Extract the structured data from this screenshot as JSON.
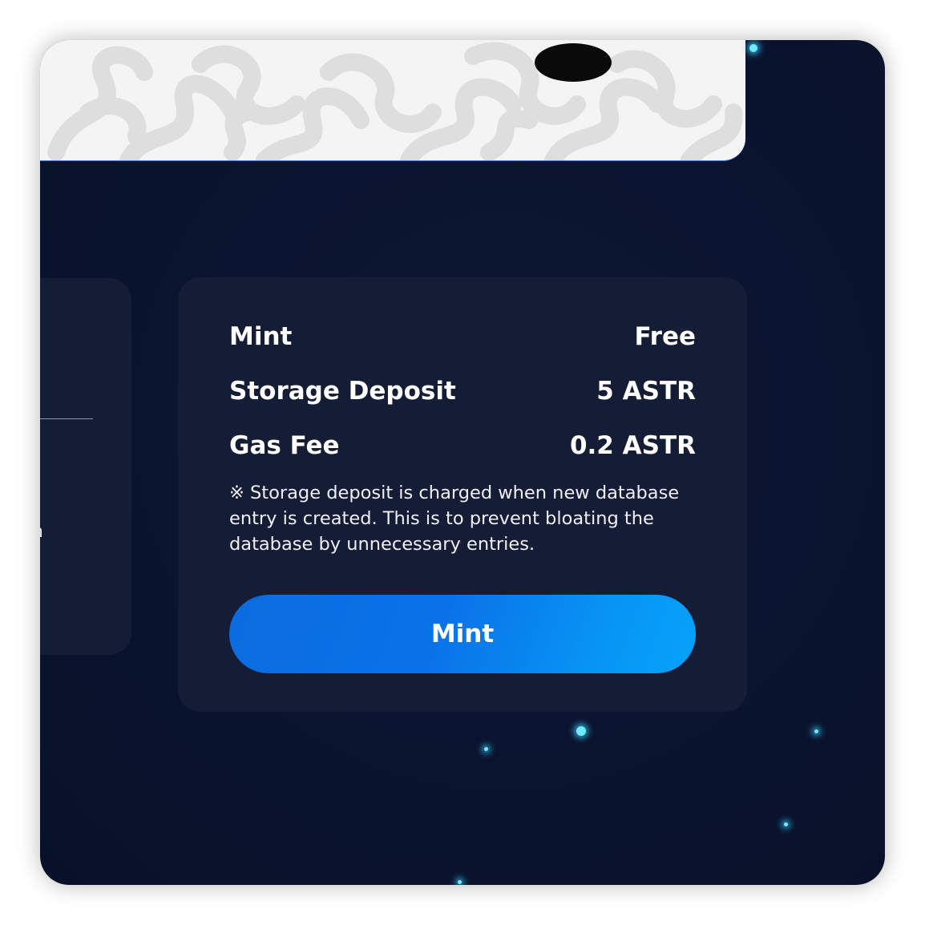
{
  "summary": {
    "rows": [
      {
        "label": "Mint",
        "value": "Free"
      },
      {
        "label": "Storage Deposit",
        "value": "5 ASTR"
      },
      {
        "label": "Gas Fee",
        "value": "0.2 ASTR"
      }
    ],
    "note": "※ Storage deposit is charged when new database entry is created. This is to prevent bloating the database by unnecessary entries.",
    "button_label": "Mint"
  },
  "left_panel": {
    "partial_text": "n"
  },
  "colors": {
    "background": "#0b1430",
    "card": "#141d35",
    "button_start": "#0a6cdf",
    "button_end": "#06a2fb",
    "star": "#6fe9ff"
  }
}
